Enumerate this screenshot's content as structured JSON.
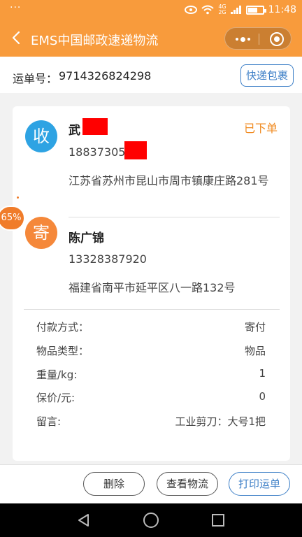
{
  "status_bar": {
    "dots": "···",
    "network": [
      "4G",
      "2G"
    ],
    "time": "11:48"
  },
  "header": {
    "title": "EMS中国邮政速递物流",
    "icons": [
      "back-icon",
      "more-icon",
      "target-icon"
    ]
  },
  "waybill": {
    "label": "运单号：",
    "number": "9714326824298",
    "tag": "快递包裹"
  },
  "recipient": {
    "avatar_char": "收",
    "name": "武",
    "phone": "18837305",
    "address": "江苏省苏州市昆山市周市镇康庄路281号",
    "status": "已下单"
  },
  "sender": {
    "avatar_char": "寄",
    "name": "陈广锦",
    "phone": "13328387920",
    "address": "福建省南平市延平区八一路132号"
  },
  "details": [
    {
      "label": "付款方式：",
      "value": "寄付"
    },
    {
      "label": "物品类型：",
      "value": "物品"
    },
    {
      "label": "重量/kg:",
      "value": "1"
    },
    {
      "label": "保价/元:",
      "value": "0"
    },
    {
      "label": "留言:",
      "value": "工业剪刀：大号1把"
    }
  ],
  "progress_badge": "65%",
  "actions": {
    "delete": "删除",
    "track": "查看物流",
    "print": "打印运单"
  },
  "colors": {
    "header_bg": "#f89b3c",
    "accent_blue": "#3d7fc7",
    "recv_avatar": "#2ea3e3",
    "send_avatar": "#f5883a",
    "status_orange": "#f08b22"
  }
}
